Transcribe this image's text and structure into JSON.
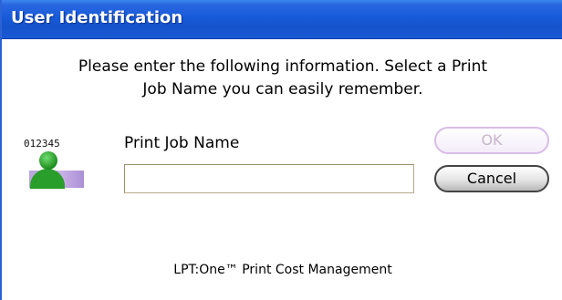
{
  "window": {
    "title": "User Identification"
  },
  "instructions": {
    "line1": "Please enter the following information. Select a Print",
    "line2": "Job Name you can easily remember."
  },
  "icon": {
    "name": "user-id-icon",
    "digits": "012345",
    "colors": {
      "person": "#2a9e2a",
      "band": "#c3acdf"
    }
  },
  "form": {
    "print_job_label": "Print Job Name",
    "print_job_value": "",
    "print_job_placeholder": ""
  },
  "buttons": {
    "ok_label": "OK",
    "ok_state": "disabled",
    "cancel_label": "Cancel"
  },
  "footer": {
    "text": "LPT:One™ Print Cost Management"
  },
  "colors": {
    "titlebar": "#175ad8",
    "title_text": "#ffffff",
    "ok_border": "#d8bde8",
    "cancel_border": "#444444"
  }
}
